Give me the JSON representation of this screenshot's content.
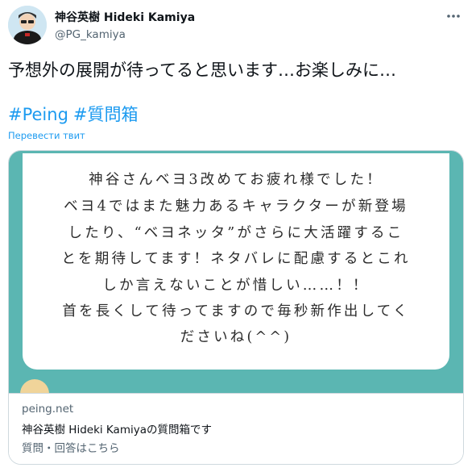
{
  "author": {
    "name": "神谷英樹 Hideki Kamiya",
    "handle": "@PG_kamiya"
  },
  "more_icon": "more-horizontal-icon",
  "tweet": {
    "text": "予想外の展開が待ってると思います…お楽しみに…",
    "hashtags": [
      "#Peing",
      "#質問箱"
    ],
    "translate_label": "Перевести твит"
  },
  "card": {
    "image_lines": [
      "神谷さんベヨ3改めてお疲れ様でした！",
      "ベヨ4ではまた魅力あるキャラクターが新登場",
      "したり、“ベヨネッタ”がさらに大活躍するこ",
      "とを期待してます！ネタバレに配慮するとこれ",
      "しか言えないことが惜しい……！！",
      "首を長くして待ってますので毎秒新作出してく",
      "ださいね(^^)"
    ],
    "domain": "peing.net",
    "title": "神谷英樹 Hideki Kamiyaの質問箱です",
    "description": "質問・回答はこちら"
  },
  "colors": {
    "link": "#1d9bf0",
    "secondary_text": "#536471",
    "card_bg": "#5bb6b2",
    "border": "#cfd9de"
  }
}
